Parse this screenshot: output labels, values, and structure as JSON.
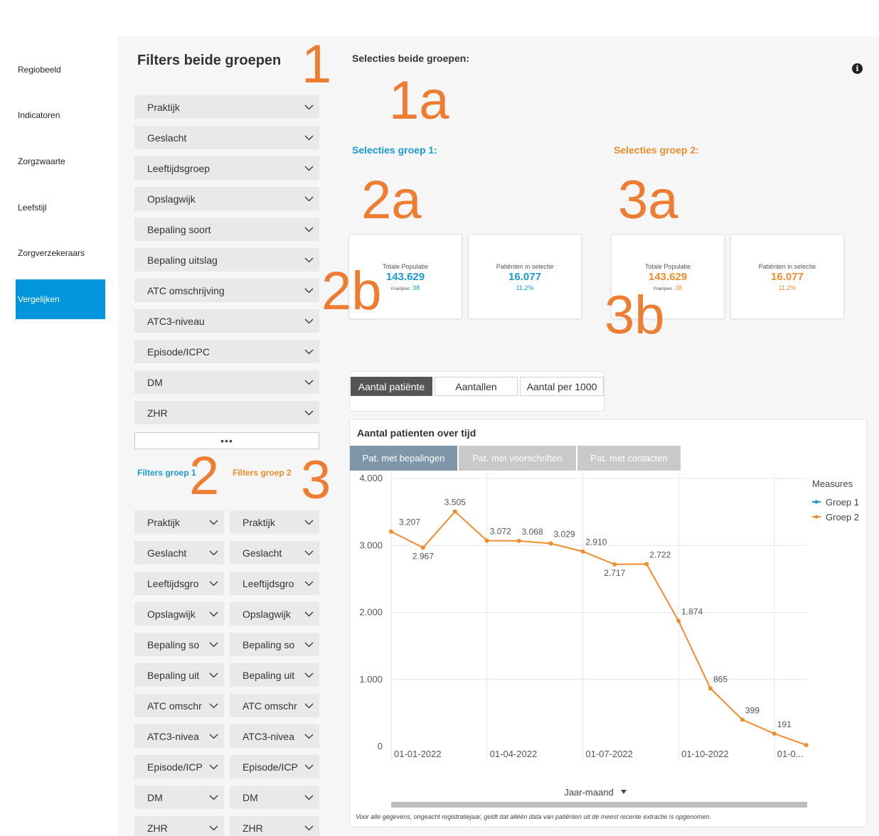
{
  "sidebar": {
    "items": [
      {
        "label": "Regiobeeld",
        "active": false
      },
      {
        "label": "Indicatoren",
        "active": false
      },
      {
        "label": "Zorgzwaarte",
        "active": false
      },
      {
        "label": "Leefstijl",
        "active": false
      },
      {
        "label": "Zorgverzekeraars",
        "active": false
      },
      {
        "label": "Vergelijken",
        "active": true
      }
    ]
  },
  "filters": {
    "title": "Filters beide groepen",
    "both": [
      "Praktijk",
      "Geslacht",
      "Leeftijdsgroep",
      "Opslagwijk",
      "Bepaling soort",
      "Bepaling uitslag",
      "ATC omschrijving",
      "ATC3-niveau",
      "Episode/ICPC",
      "DM",
      "ZHR"
    ],
    "more_label": "•••",
    "group1_label": "Filters groep 1",
    "group2_label": "Filters groep 2",
    "group1": [
      "Praktijk",
      "Geslacht",
      "Leeftijdsgro",
      "Opslagwijk",
      "Bepaling so",
      "Bepaling uit",
      "ATC omschr",
      "ATC3-nivea",
      "Episode/ICP",
      "DM",
      "ZHR"
    ],
    "group2": [
      "Praktijk",
      "Geslacht",
      "Leeftijdsgro",
      "Opslagwijk",
      "Bepaling so",
      "Bepaling uit",
      "ATC omschr",
      "ATC3-nivea",
      "Episode/ICP",
      "DM",
      "ZHR"
    ]
  },
  "selections": {
    "both_label": "Selecties beide groepen:",
    "group1_label": "Selecties groep 1:",
    "group2_label": "Selecties groep 2:",
    "info_icon": "i"
  },
  "annotations": {
    "a1": "1",
    "a1a": "1a",
    "a2": "2",
    "a2a": "2a",
    "a2b": "2b",
    "a3": "3",
    "a3a": "3a",
    "a3b": "3b"
  },
  "kpis": {
    "group1": {
      "total_label": "Totale Populatie",
      "total_value": "143.629",
      "practices_label": "Praktijken",
      "practices_value": "38",
      "sel_label": "Patiënten in selectie",
      "sel_value": "16.077",
      "sel_pct": "11,2%"
    },
    "group2": {
      "total_label": "Totale Populatie",
      "total_value": "143.629",
      "practices_label": "Praktijken",
      "practices_value": "38",
      "sel_label": "Patiënten in selectie",
      "sel_value": "16.077",
      "sel_pct": "11,2%"
    }
  },
  "toggle": [
    "Aantal patiënte",
    "Aantallen",
    "Aantal per 1000"
  ],
  "chart": {
    "title": "Aantal patienten over tijd",
    "tabs": [
      "Pat. met bepalingen",
      "Pat. met voorschriften",
      "Pat. met contacten"
    ],
    "footnote": "Voor alle gegevens, ongeacht registratiejaar, geldt dat alléén data van patiënten uit de meest recente extractie is opgenomen.",
    "colors": {
      "groep1": "#1a99d8",
      "groep2": "#f08c2c"
    }
  },
  "chart_data": {
    "type": "line",
    "xlabel": "Jaar-maand",
    "ylabel": "",
    "ylim": [
      0,
      4000
    ],
    "y_ticks": [
      "0",
      "1.000",
      "2.000",
      "3.000",
      "4.000"
    ],
    "x_tick_labels": [
      "01-01-2022",
      "01-04-2022",
      "01-07-2022",
      "01-10-2022",
      "01-0..."
    ],
    "legend_title": "Measures",
    "legend_position": "right",
    "grid": true,
    "x": [
      "2022-01",
      "2022-02",
      "2022-03",
      "2022-04",
      "2022-05",
      "2022-06",
      "2022-07",
      "2022-08",
      "2022-09",
      "2022-10",
      "2022-11",
      "2022-12",
      "2023-01",
      "2023-02"
    ],
    "series": [
      {
        "name": "Groep 1",
        "values": []
      },
      {
        "name": "Groep 2",
        "values": [
          3207,
          2967,
          3505,
          3072,
          3068,
          3029,
          2910,
          2717,
          2722,
          1874,
          865,
          399,
          191,
          20
        ]
      }
    ],
    "data_labels": [
      "3.207",
      "2.967",
      "3.505",
      "3.072",
      "3.068",
      "3.029",
      "2.910",
      "2.717",
      "2.722",
      "1.874",
      "865",
      "399",
      "191",
      ""
    ]
  }
}
